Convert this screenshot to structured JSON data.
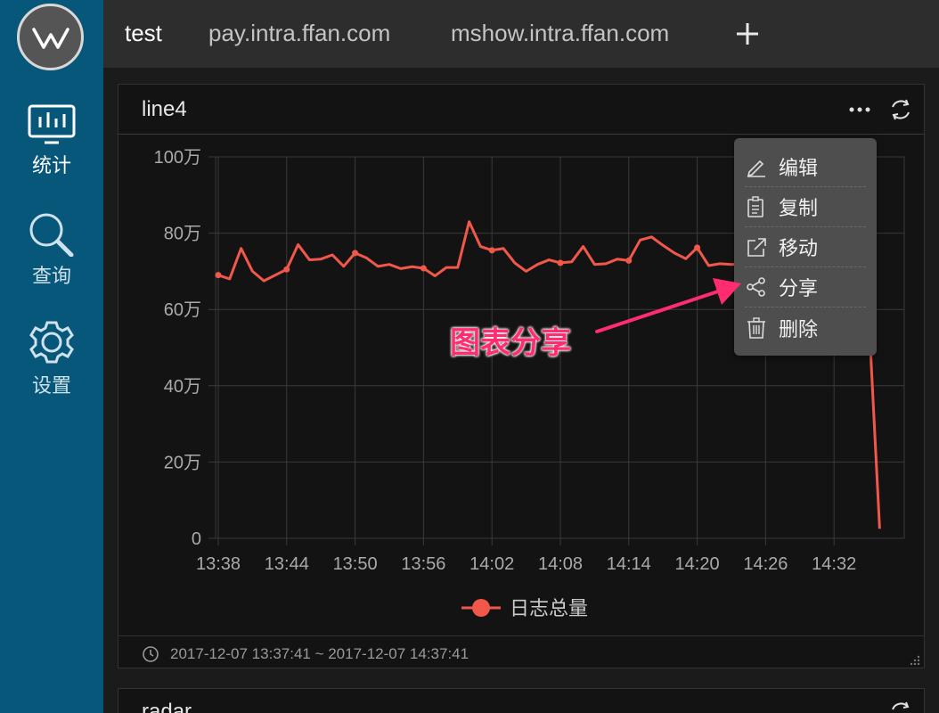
{
  "sidebar": {
    "items": [
      {
        "label": "统计",
        "icon": "chart-monitor-icon",
        "active": true
      },
      {
        "label": "查询",
        "icon": "search-icon",
        "active": false
      },
      {
        "label": "设置",
        "icon": "gear-icon",
        "active": false
      }
    ]
  },
  "tabs": [
    {
      "label": "test",
      "active": true
    },
    {
      "label": "pay.intra.ffan.com",
      "active": false
    },
    {
      "label": "mshow.intra.ffan.com",
      "active": false
    }
  ],
  "panel": {
    "title": "line4",
    "time_range": "2017-12-07 13:37:41 ~ 2017-12-07 14:37:41"
  },
  "panel2": {
    "title": "radar"
  },
  "menu": {
    "items": [
      {
        "label": "编辑",
        "icon": "edit-icon"
      },
      {
        "label": "复制",
        "icon": "copy-icon"
      },
      {
        "label": "移动",
        "icon": "move-icon"
      },
      {
        "label": "分享",
        "icon": "share-icon"
      },
      {
        "label": "删除",
        "icon": "trash-icon"
      }
    ]
  },
  "annotation": {
    "text": "图表分享",
    "color": "#ff2d6f"
  },
  "colors": {
    "sidebar": "#07577a",
    "series": "#f2584a",
    "accent_annotation": "#ff2d6f"
  },
  "chart_data": {
    "type": "line",
    "x_ticks": [
      "13:38",
      "13:44",
      "13:50",
      "13:56",
      "14:02",
      "14:08",
      "14:14",
      "14:20",
      "14:26",
      "14:32"
    ],
    "y_ticks": [
      "0",
      "20万",
      "40万",
      "60万",
      "80万",
      "100万"
    ],
    "ylim": [
      0,
      1000000
    ],
    "grid": true,
    "legend_position": "bottom",
    "series": [
      {
        "name": "日志总量",
        "color": "#f2584a",
        "x_minutes": [
          0,
          1,
          2,
          3,
          4,
          5,
          6,
          7,
          8,
          9,
          10,
          11,
          12,
          13,
          14,
          15,
          16,
          17,
          18,
          19,
          20,
          21,
          22,
          23,
          24,
          25,
          26,
          27,
          28,
          29,
          30,
          31,
          32,
          33,
          34,
          35,
          36,
          37,
          38,
          39,
          40,
          41,
          42,
          43,
          44,
          45,
          46,
          47,
          48,
          49,
          50,
          51,
          52,
          53,
          54,
          55,
          56,
          57,
          58
        ],
        "values": [
          690000,
          680000,
          760000,
          700000,
          675000,
          690000,
          705000,
          770000,
          730000,
          732000,
          743000,
          713000,
          748000,
          735000,
          713000,
          718000,
          707000,
          712000,
          708000,
          688000,
          710000,
          710000,
          830000,
          765000,
          755000,
          760000,
          722000,
          700000,
          718000,
          730000,
          722000,
          725000,
          765000,
          718000,
          720000,
          732000,
          728000,
          782000,
          790000,
          768000,
          748000,
          733000,
          762000,
          715000,
          720000,
          718000,
          720000,
          710000,
          715000,
          718000,
          722000,
          725000,
          735000,
          738000,
          765000,
          770000,
          790000,
          610000,
          25000
        ]
      }
    ]
  }
}
